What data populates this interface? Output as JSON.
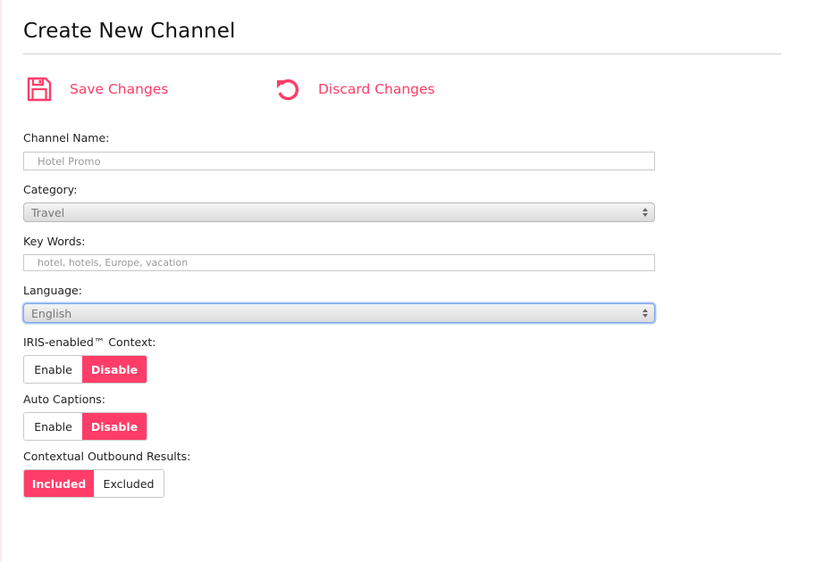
{
  "page": {
    "title": "Create New Channel",
    "accent_color": "#ff3d68"
  },
  "actions": {
    "save": {
      "label": "Save Changes",
      "icon": "floppy-disk-icon"
    },
    "discard": {
      "label": "Discard Changes",
      "icon": "undo-icon"
    }
  },
  "form": {
    "channel_name": {
      "label": "Channel Name:",
      "placeholder": "Hotel Promo"
    },
    "category": {
      "label": "Category:",
      "value": "Travel"
    },
    "keywords": {
      "label": "Key Words:",
      "placeholder": "hotel, hotels, Europe, vacation"
    },
    "language": {
      "label": "Language:",
      "value": "English"
    },
    "iris_context": {
      "label": "IRIS-enabled™ Context:",
      "options": [
        "Enable",
        "Disable"
      ],
      "selected": "Disable"
    },
    "auto_captions": {
      "label": "Auto Captions:",
      "options": [
        "Enable",
        "Disable"
      ],
      "selected": "Disable"
    },
    "outbound_results": {
      "label": "Contextual Outbound Results:",
      "options": [
        "Included",
        "Excluded"
      ],
      "selected": "Included"
    }
  }
}
